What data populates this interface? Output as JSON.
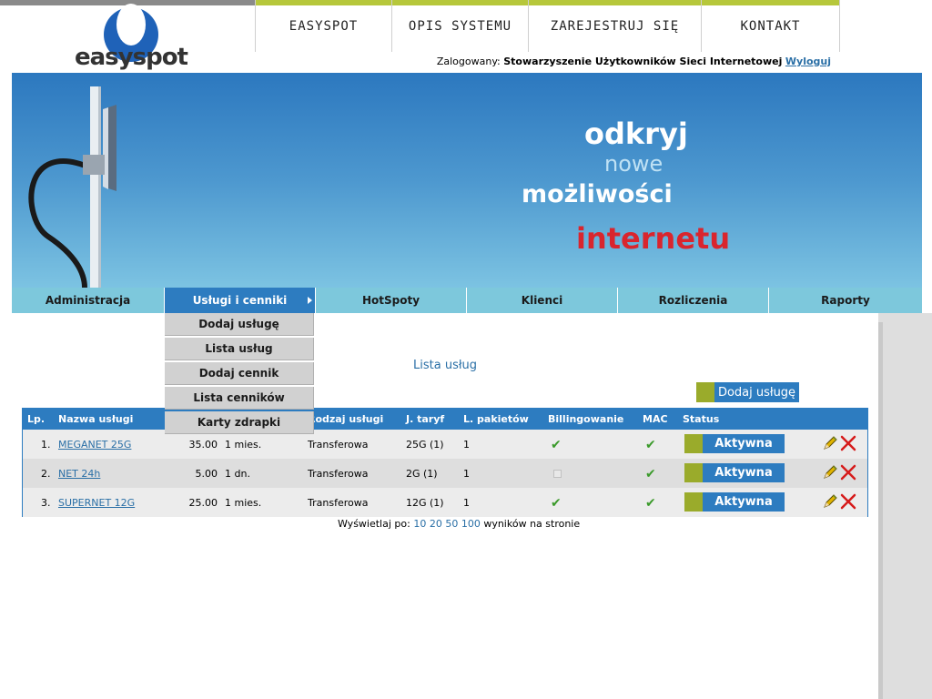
{
  "header": {
    "logo_text": "easyspot",
    "nav": [
      "EASYSPOT",
      "OPIS SYSTEMU",
      "ZAREJESTRUJ SIĘ",
      "KONTAKT"
    ],
    "login_label": "Zalogowany:",
    "login_user": "Stowarzyszenie Użytkowników Sieci Internetowej",
    "logout": "Wyloguj"
  },
  "banner": {
    "line1": "odkryj",
    "line2": "nowe",
    "line3": "możliwości",
    "line4": "internetu"
  },
  "menu": {
    "items": [
      "Administracja",
      "Usługi i cenniki",
      "HotSpoty",
      "Klienci",
      "Rozliczenia",
      "Raporty"
    ],
    "active": "Usługi i cenniki"
  },
  "dropdown": {
    "items": [
      "Dodaj usługę",
      "Lista usług",
      "Dodaj cennik",
      "Lista cenników",
      "Karty zdrapki"
    ]
  },
  "page": {
    "title": "Lista usług",
    "add_button": "Dodaj usługę"
  },
  "table": {
    "headers": [
      "Lp.",
      "Nazwa usługi",
      "Rodzaj usługi",
      "J. taryf",
      "L. pakietów",
      "Billingowanie",
      "MAC",
      "Status"
    ],
    "rows": [
      {
        "lp": "1.",
        "name": "MEGANET 25G",
        "price": "35.00",
        "period": "1 mies.",
        "type": "Transferowa",
        "tariff": "25G (1)",
        "packets": "1",
        "billing": true,
        "mac": true,
        "status": "Aktywna"
      },
      {
        "lp": "2.",
        "name": "NET 24h",
        "price": "5.00",
        "period": "1 dn.",
        "type": "Transferowa",
        "tariff": "2G (1)",
        "packets": "1",
        "billing": false,
        "mac": true,
        "status": "Aktywna"
      },
      {
        "lp": "3.",
        "name": "SUPERNET 12G",
        "price": "25.00",
        "period": "1 mies.",
        "type": "Transferowa",
        "tariff": "12G (1)",
        "packets": "1",
        "billing": true,
        "mac": true,
        "status": "Aktywna"
      }
    ]
  },
  "pager": {
    "label": "Wyświetlaj po:",
    "options": [
      "10",
      "20",
      "50",
      "100"
    ],
    "suffix": "wyników na stronie"
  },
  "colors": {
    "accent_blue": "#2d7cc0",
    "accent_green": "#9aab2b",
    "menu_bg": "#7dc8dc",
    "banner_red": "#d9252e"
  }
}
